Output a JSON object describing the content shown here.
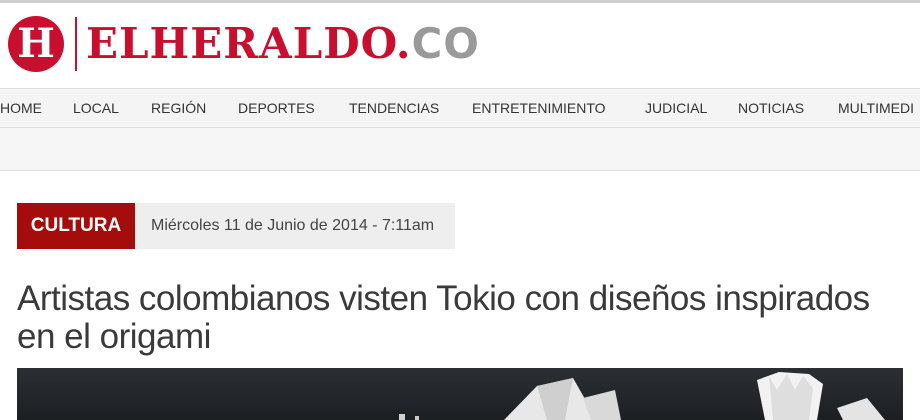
{
  "logo": {
    "mark": "H",
    "name": "ELHERALDO",
    "dot": ".",
    "tld": "CO"
  },
  "nav": {
    "items": [
      "HOME",
      "LOCAL",
      "REGIÓN",
      "DEPORTES",
      "TENDENCIAS",
      "ENTRETENIMIENTO",
      "JUDICIAL",
      "NOTICIAS",
      "MULTIMEDI"
    ]
  },
  "article": {
    "section": "CULTURA",
    "date": "Miércoles 11 de Junio de 2014 - 7:11am",
    "headline": "Artistas colombianos visten Tokio con diseños inspirados en el origami"
  },
  "colors": {
    "brand": "#c8102e",
    "section_badge": "#a50d0d",
    "tld_gray": "#9a9a9a"
  }
}
